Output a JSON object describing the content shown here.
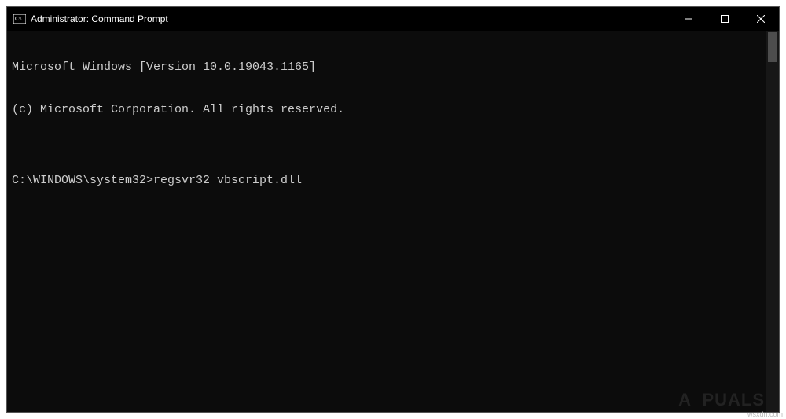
{
  "window": {
    "title": "Administrator: Command Prompt",
    "icon_name": "cmd-icon"
  },
  "terminal": {
    "lines": [
      "Microsoft Windows [Version 10.0.19043.1165]",
      "(c) Microsoft Corporation. All rights reserved.",
      "",
      "C:\\WINDOWS\\system32>regsvr32 vbscript.dll"
    ]
  },
  "watermark": "A  PUALS",
  "attribution": "wsxdn.com"
}
